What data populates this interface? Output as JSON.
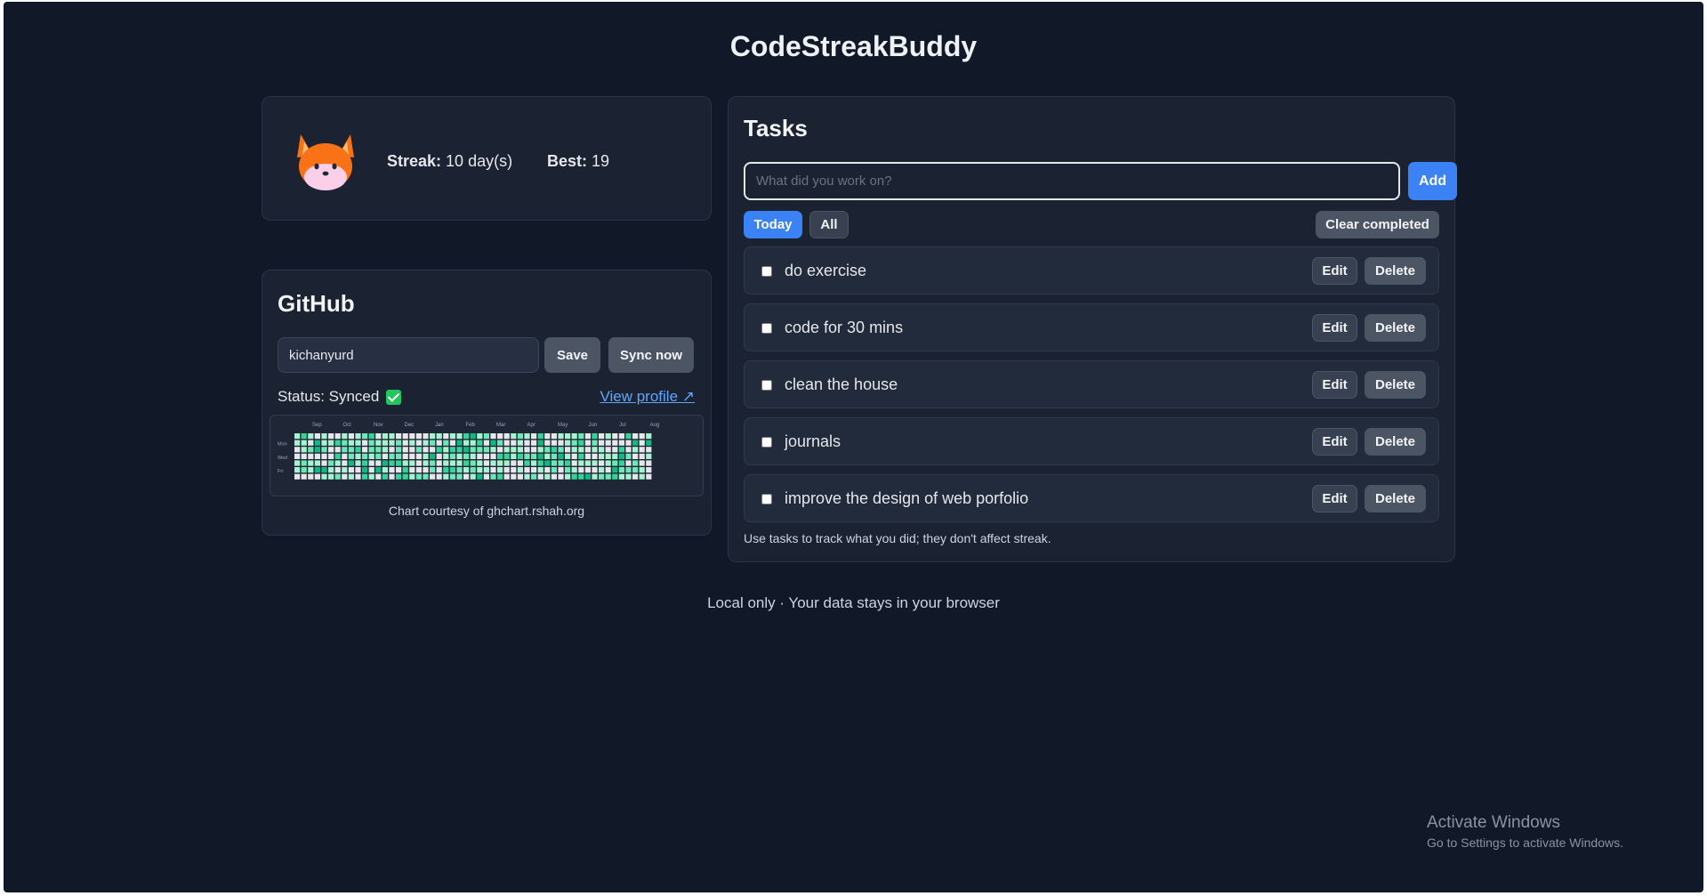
{
  "app": {
    "title": "CodeStreakBuddy"
  },
  "profile": {
    "streak_label": "Streak:",
    "streak_value": "10 day(s)",
    "best_label": "Best:",
    "best_value": "19",
    "avatar_icon": "fox-icon"
  },
  "github": {
    "title": "GitHub",
    "username_value": "kichanyurd",
    "save_label": "Save",
    "sync_label": "Sync now",
    "status_text": "Status: Synced",
    "status_icon": "check-icon",
    "view_profile_label": "View profile ↗",
    "chart_credit": "Chart courtesy of ghchart.rshah.org",
    "contrib_months": [
      "Sep",
      "Oct",
      "Nov",
      "Dec",
      "Jan",
      "Feb",
      "Mar",
      "Apr",
      "May",
      "Jun",
      "Jul",
      "Aug"
    ],
    "contrib_days": [
      "Mon",
      "Wed",
      "Fri"
    ]
  },
  "tasks": {
    "title": "Tasks",
    "input_placeholder": "What did you work on?",
    "add_label": "Add",
    "filter_today": "Today",
    "filter_all": "All",
    "clear_label": "Clear completed",
    "edit_label": "Edit",
    "delete_label": "Delete",
    "items": [
      {
        "text": "do exercise",
        "done": false
      },
      {
        "text": "code for 30 mins",
        "done": false
      },
      {
        "text": "clean the house",
        "done": false
      },
      {
        "text": "journals",
        "done": false
      },
      {
        "text": "improve the design of web porfolio",
        "done": false
      }
    ],
    "note": "Use tasks to track what you did; they don't affect streak."
  },
  "footer": {
    "text": "Local only · Your data stays in your browser"
  },
  "watermark": {
    "title": "Activate Windows",
    "subtitle": "Go to Settings to activate Windows."
  },
  "colors": {
    "background": "#111827",
    "card": "#1b2333",
    "accent": "#3b82f6",
    "synced": "#22c55e"
  }
}
